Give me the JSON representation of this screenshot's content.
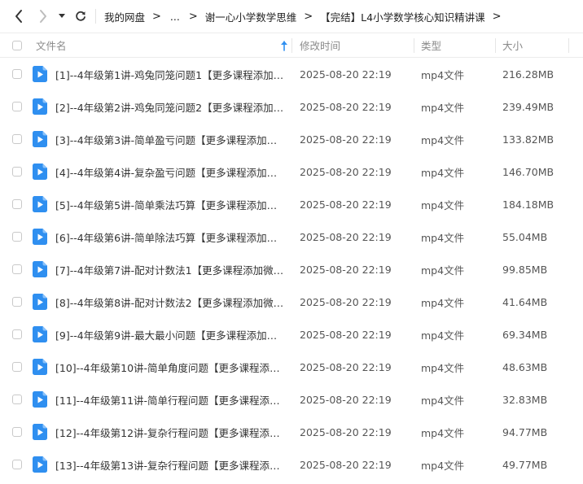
{
  "nav": {
    "back_icon": "chevron-left-icon",
    "forward_icon": "chevron-right-icon",
    "dropdown_icon": "caret-down-icon",
    "refresh_icon": "refresh-icon"
  },
  "breadcrumb": {
    "items": [
      "我的网盘",
      "...",
      "谢一心小学数学思维",
      "【完结】L4小学数学核心知识精讲课"
    ],
    "separator": ">"
  },
  "header": {
    "name": "文件名",
    "modified": "修改时间",
    "type": "类型",
    "size": "大小",
    "sort_icon": "sort-up-arrow-icon"
  },
  "colors": {
    "accent": "#2f8ff0",
    "text": "#333333",
    "header_text": "#8a8a8a",
    "divider": "#ececec"
  },
  "files": [
    {
      "name": "[1]--4年级第1讲-鸡兔同笼问题1【更多课程添加微...",
      "modified": "2025-08-20 22:19",
      "type": "mp4文件",
      "size": "216.28MB"
    },
    {
      "name": "[2]--4年级第2讲-鸡兔同笼问题2【更多课程添加微...",
      "modified": "2025-08-20 22:19",
      "type": "mp4文件",
      "size": "239.49MB"
    },
    {
      "name": "[3]--4年级第3讲-简单盈亏问题【更多课程添加微...",
      "modified": "2025-08-20 22:19",
      "type": "mp4文件",
      "size": "133.82MB"
    },
    {
      "name": "[4]--4年级第4讲-复杂盈亏问题【更多课程添加微...",
      "modified": "2025-08-20 22:19",
      "type": "mp4文件",
      "size": "146.70MB"
    },
    {
      "name": "[5]--4年级第5讲-简单乘法巧算【更多课程添加微...",
      "modified": "2025-08-20 22:19",
      "type": "mp4文件",
      "size": "184.18MB"
    },
    {
      "name": "[6]--4年级第6讲-简单除法巧算【更多课程添加微...",
      "modified": "2025-08-20 22:19",
      "type": "mp4文件",
      "size": "55.04MB"
    },
    {
      "name": "[7]--4年级第7讲-配对计数法1【更多课程添加微信...",
      "modified": "2025-08-20 22:19",
      "type": "mp4文件",
      "size": "99.85MB"
    },
    {
      "name": "[8]--4年级第8讲-配对计数法2【更多课程添加微信...",
      "modified": "2025-08-20 22:19",
      "type": "mp4文件",
      "size": "41.64MB"
    },
    {
      "name": "[9]--4年级第9讲-最大最小问题【更多课程添加微...",
      "modified": "2025-08-20 22:19",
      "type": "mp4文件",
      "size": "69.34MB"
    },
    {
      "name": "[10]--4年级第10讲-简单角度问题【更多课程添加...",
      "modified": "2025-08-20 22:19",
      "type": "mp4文件",
      "size": "48.63MB"
    },
    {
      "name": "[11]--4年级第11讲-简单行程问题【更多课程添加...",
      "modified": "2025-08-20 22:19",
      "type": "mp4文件",
      "size": "32.83MB"
    },
    {
      "name": "[12]--4年级第12讲-复杂行程问题【更多课程添加...",
      "modified": "2025-08-20 22:19",
      "type": "mp4文件",
      "size": "94.77MB"
    },
    {
      "name": "[13]--4年级第13讲-复杂行程问题【更多课程添加...",
      "modified": "2025-08-20 22:19",
      "type": "mp4文件",
      "size": "49.77MB"
    }
  ]
}
